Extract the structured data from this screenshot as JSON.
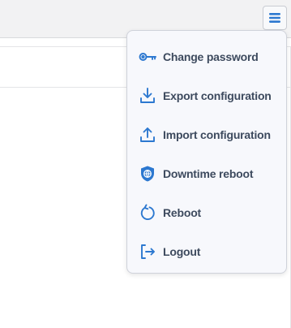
{
  "accent_color": "#2c78d0",
  "toolbar": {
    "menu_button_icon": "hamburger-icon"
  },
  "menu": {
    "items": [
      {
        "label": "Change password",
        "icon": "key-icon"
      },
      {
        "label": "Export configuration",
        "icon": "download-icon"
      },
      {
        "label": "Import configuration",
        "icon": "upload-icon"
      },
      {
        "label": "Downtime reboot",
        "icon": "shield-globe-icon"
      },
      {
        "label": "Reboot",
        "icon": "reboot-icon"
      },
      {
        "label": "Logout",
        "icon": "logout-icon"
      }
    ]
  }
}
